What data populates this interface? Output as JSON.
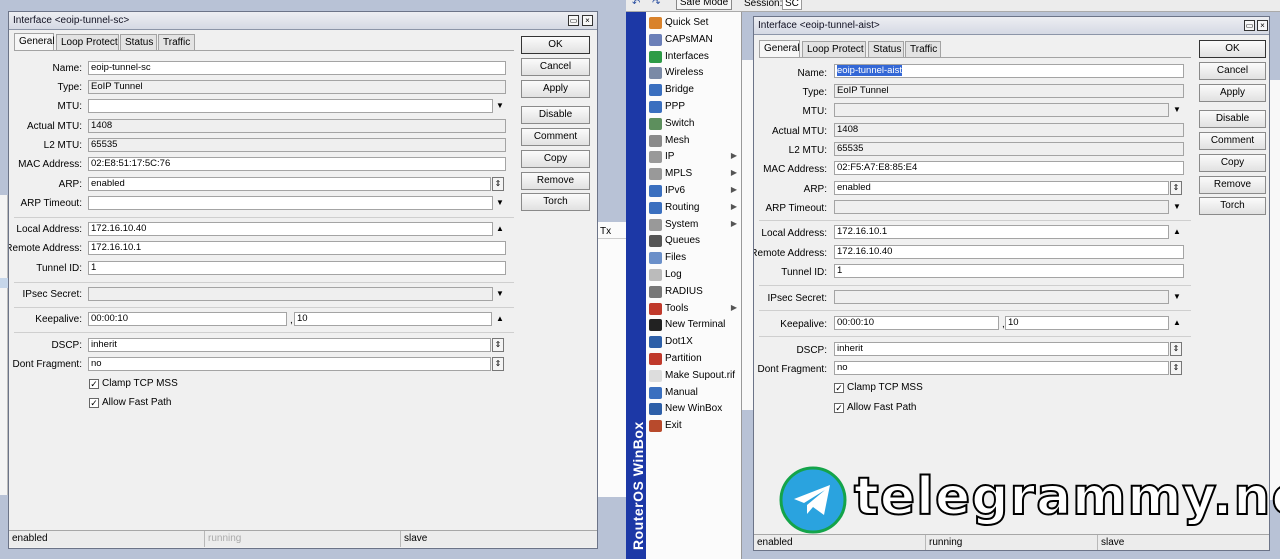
{
  "toolbar": {
    "undo_icon": "undo-icon",
    "redo_icon": "redo-icon",
    "safe_mode": "Safe Mode",
    "session_label": "Session:",
    "session_value": "SC"
  },
  "left": {
    "title": "Interface <eoip-tunnel-sc>",
    "tabs": [
      "General",
      "Loop Protect",
      "Status",
      "Traffic"
    ],
    "labels": {
      "name": "Name:",
      "type": "Type:",
      "mtu": "MTU:",
      "actual_mtu": "Actual MTU:",
      "l2_mtu": "L2 MTU:",
      "mac": "MAC Address:",
      "arp": "ARP:",
      "arp_timeout": "ARP Timeout:",
      "local": "Local Address:",
      "remote": "Remote Address:",
      "tunnel_id": "Tunnel ID:",
      "ipsec": "IPsec Secret:",
      "keepalive": "Keepalive:",
      "dscp": "DSCP:",
      "dont_frag": "Dont Fragment:"
    },
    "values": {
      "name": "eoip-tunnel-sc",
      "type": "EoIP Tunnel",
      "mtu": "",
      "actual_mtu": "1408",
      "l2_mtu": "65535",
      "mac": "02:E8:51:17:5C:76",
      "arp": "enabled",
      "arp_timeout": "",
      "local": "172.16.10.40",
      "remote": "172.16.10.1",
      "tunnel_id": "1",
      "ipsec": "",
      "keepalive_interval": "00:00:10",
      "keepalive_count": "10",
      "keepalive_sep": ",",
      "dscp": "inherit",
      "dont_frag": "no"
    },
    "checks": {
      "clamp": "Clamp TCP MSS",
      "fast_path": "Allow Fast Path"
    },
    "buttons": {
      "ok": "OK",
      "cancel": "Cancel",
      "apply": "Apply",
      "disable": "Disable",
      "comment": "Comment",
      "copy": "Copy",
      "remove": "Remove",
      "torch": "Torch"
    },
    "status": {
      "s1": "enabled",
      "s2": "running",
      "s3": "slave"
    }
  },
  "right": {
    "title": "Interface <eoip-tunnel-aist>",
    "tabs": [
      "General",
      "Loop Protect",
      "Status",
      "Traffic"
    ],
    "labels": {
      "name": "Name:",
      "type": "Type:",
      "mtu": "MTU:",
      "actual_mtu": "Actual MTU:",
      "l2_mtu": "L2 MTU:",
      "mac": "MAC Address:",
      "arp": "ARP:",
      "arp_timeout": "ARP Timeout:",
      "local": "Local Address:",
      "remote": "Remote Address:",
      "tunnel_id": "Tunnel ID:",
      "ipsec": "IPsec Secret:",
      "keepalive": "Keepalive:",
      "dscp": "DSCP:",
      "dont_frag": "Dont Fragment:"
    },
    "values": {
      "name": "eoip-tunnel-aist",
      "type": "EoIP Tunnel",
      "mtu": "",
      "actual_mtu": "1408",
      "l2_mtu": "65535",
      "mac": "02:F5:A7:E8:85:E4",
      "arp": "enabled",
      "arp_timeout": "",
      "local": "172.16.10.1",
      "remote": "172.16.10.40",
      "tunnel_id": "1",
      "ipsec": "",
      "keepalive_interval": "00:00:10",
      "keepalive_count": "10",
      "keepalive_sep": ",",
      "dscp": "inherit",
      "dont_frag": "no"
    },
    "checks": {
      "clamp": "Clamp TCP MSS",
      "fast_path": "Allow Fast Path"
    },
    "buttons": {
      "ok": "OK",
      "cancel": "Cancel",
      "apply": "Apply",
      "disable": "Disable",
      "comment": "Comment",
      "copy": "Copy",
      "remove": "Remove",
      "torch": "Torch"
    },
    "status": {
      "s1": "enabled",
      "s2": "running",
      "s3": "slave"
    }
  },
  "menu": {
    "vertical_title": "RouterOS WinBox",
    "items": [
      {
        "label": "Quick Set",
        "icon": "quick-set-icon",
        "color": "#d9822b",
        "arrow": ""
      },
      {
        "label": "CAPsMAN",
        "icon": "capsman-icon",
        "color": "#6b7fb8",
        "arrow": ""
      },
      {
        "label": "Interfaces",
        "icon": "interfaces-icon",
        "color": "#2d9b46",
        "arrow": ""
      },
      {
        "label": "Wireless",
        "icon": "wireless-icon",
        "color": "#7a8aa6",
        "arrow": ""
      },
      {
        "label": "Bridge",
        "icon": "bridge-icon",
        "color": "#3a6fbf",
        "arrow": ""
      },
      {
        "label": "PPP",
        "icon": "ppp-icon",
        "color": "#3a6fbf",
        "arrow": ""
      },
      {
        "label": "Switch",
        "icon": "switch-icon",
        "color": "#5d8f5d",
        "arrow": ""
      },
      {
        "label": "Mesh",
        "icon": "mesh-icon",
        "color": "#8a8a8a",
        "arrow": ""
      },
      {
        "label": "IP",
        "icon": "ip-icon",
        "color": "#999999",
        "arrow": "▶"
      },
      {
        "label": "MPLS",
        "icon": "mpls-icon",
        "color": "#999999",
        "arrow": "▶"
      },
      {
        "label": "IPv6",
        "icon": "ipv6-icon",
        "color": "#3a6fbf",
        "arrow": "▶"
      },
      {
        "label": "Routing",
        "icon": "routing-icon",
        "color": "#3a6fbf",
        "arrow": "▶"
      },
      {
        "label": "System",
        "icon": "system-icon",
        "color": "#999999",
        "arrow": "▶"
      },
      {
        "label": "Queues",
        "icon": "queues-icon",
        "color": "#555555",
        "arrow": ""
      },
      {
        "label": "Files",
        "icon": "files-icon",
        "color": "#6a8fc9",
        "arrow": ""
      },
      {
        "label": "Log",
        "icon": "log-icon",
        "color": "#bbbbbb",
        "arrow": ""
      },
      {
        "label": "RADIUS",
        "icon": "radius-icon",
        "color": "#777777",
        "arrow": ""
      },
      {
        "label": "Tools",
        "icon": "tools-icon",
        "color": "#c0392b",
        "arrow": "▶"
      },
      {
        "label": "New Terminal",
        "icon": "terminal-icon",
        "color": "#222222",
        "arrow": ""
      },
      {
        "label": "Dot1X",
        "icon": "dot1x-icon",
        "color": "#2d5fa8",
        "arrow": ""
      },
      {
        "label": "Partition",
        "icon": "partition-icon",
        "color": "#c0392b",
        "arrow": ""
      },
      {
        "label": "Make Supout.rif",
        "icon": "supout-icon",
        "color": "#dddddd",
        "arrow": ""
      },
      {
        "label": "Manual",
        "icon": "manual-icon",
        "color": "#3a6fbf",
        "arrow": ""
      },
      {
        "label": "New WinBox",
        "icon": "winbox-icon",
        "color": "#2d5fa8",
        "arrow": ""
      },
      {
        "label": "Exit",
        "icon": "exit-icon",
        "color": "#b84a2c",
        "arrow": ""
      }
    ]
  },
  "background": {
    "tx_header": "Tx"
  },
  "watermark": {
    "text": "telegrammy.net",
    "logo_icon": "telegram-logo-icon"
  }
}
